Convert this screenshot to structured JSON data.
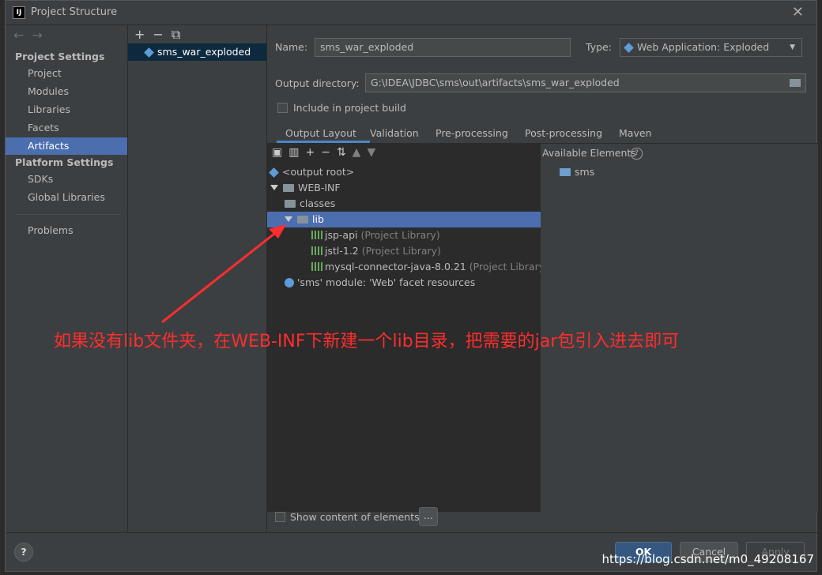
{
  "window": {
    "title": "Project Structure",
    "close_glyph": "✕"
  },
  "nav": {
    "back": "←",
    "forward": "→"
  },
  "left_panel": {
    "project_settings": "Project Settings",
    "items_top": [
      "Project",
      "Modules",
      "Libraries",
      "Facets",
      "Artifacts"
    ],
    "platform_settings": "Platform Settings",
    "items_platform": [
      "SDKs",
      "Global Libraries"
    ],
    "problems": "Problems",
    "selected": "Artifacts"
  },
  "artifacts_list": {
    "toolbar": {
      "add": "+",
      "remove": "−",
      "copy": "⧉"
    },
    "items": [
      "sms_war_exploded"
    ]
  },
  "form": {
    "name_label": "Name:",
    "name_value": "sms_war_exploded",
    "type_label": "Type:",
    "type_value": "Web Application: Exploded",
    "output_dir_label": "Output directory:",
    "output_dir_value": "G:\\IDEA\\JDBC\\sms\\out\\artifacts\\sms_war_exploded",
    "include_build_label": "Include in project build",
    "include_build_checked": false
  },
  "tabs": [
    "Output Layout",
    "Validation",
    "Pre-processing",
    "Post-processing",
    "Maven"
  ],
  "active_tab": "Output Layout",
  "layout_tree": {
    "output_root": "<output root>",
    "web_inf": "WEB-INF",
    "classes": "classes",
    "lib": "lib",
    "libs": [
      {
        "name": "jsp-api",
        "suffix": "(Project Library)"
      },
      {
        "name": "jstl-1.2",
        "suffix": "(Project Library)"
      },
      {
        "name": "mysql-connector-java-8.0.21",
        "suffix": "(Project Library)"
      }
    ],
    "facet": "'sms' module: 'Web' facet resources"
  },
  "available": {
    "label": "Available Elements",
    "help": "?",
    "items": [
      "sms"
    ]
  },
  "show_content_label": "Show content of elements",
  "ellipsis": "...",
  "buttons": {
    "ok": "OK",
    "cancel": "Cancel",
    "apply": "Apply",
    "help": "?"
  },
  "annotation": "如果没有lib文件夹，在WEB-INF下新建一个lib目录，把需要的jar包引入进去即可",
  "watermark": "https://blog.csdn.net/m0_49208167",
  "colors": {
    "selection": "#4b6eaf",
    "annotation": "#ff2d2d",
    "ok_button": "#365880"
  }
}
